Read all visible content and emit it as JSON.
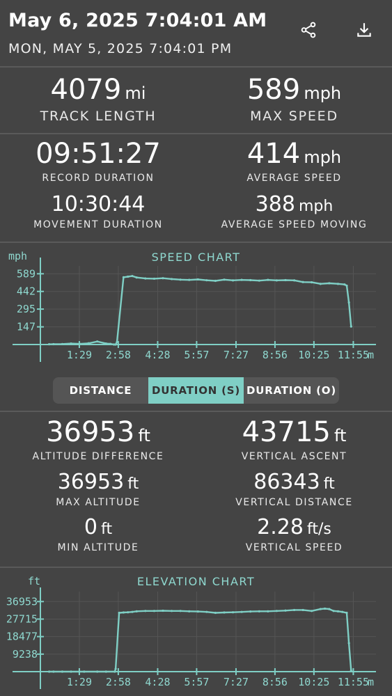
{
  "header": {
    "title": "May 6, 2025 7:04:01 AM",
    "subtitle": "MON, MAY 5, 2025 7:04:01 PM",
    "icons": [
      "share-icon",
      "download-icon"
    ]
  },
  "stats_top": {
    "track_length": {
      "value": "4079",
      "unit": "mi",
      "label": "TRACK LENGTH"
    },
    "max_speed": {
      "value": "589",
      "unit": "mph",
      "label": "MAX SPEED"
    },
    "record_duration": {
      "value": "09:51:27",
      "label": "RECORD DURATION"
    },
    "average_speed": {
      "value": "414",
      "unit": "mph",
      "label": "AVERAGE SPEED"
    },
    "movement_duration": {
      "value": "10:30:44",
      "label": "MOVEMENT DURATION"
    },
    "average_speed_moving": {
      "value": "388",
      "unit": "mph",
      "label": "AVERAGE SPEED MOVING"
    }
  },
  "segmented": {
    "options": [
      "DISTANCE",
      "DURATION (S)",
      "DURATION (O)"
    ],
    "selected": "DURATION (S)"
  },
  "stats_bottom": {
    "altitude_difference": {
      "value": "36953",
      "unit": "ft",
      "label": "ALTITUDE DIFFERENCE"
    },
    "vertical_ascent": {
      "value": "43715",
      "unit": "ft",
      "label": "VERTICAL ASCENT"
    },
    "max_altitude": {
      "value": "36953",
      "unit": "ft",
      "label": "MAX ALTITUDE"
    },
    "vertical_distance": {
      "value": "86343",
      "unit": "ft",
      "label": "VERTICAL DISTANCE"
    },
    "min_altitude": {
      "value": "0",
      "unit": "ft",
      "label": "MIN ALTITUDE"
    },
    "vertical_speed": {
      "value": "2.28",
      "unit": "ft/s",
      "label": "VERTICAL SPEED"
    }
  },
  "colors": {
    "accent": "#7fcfc5",
    "background": "#444444",
    "divider": "#5a5a5a"
  },
  "chart_data": [
    {
      "type": "line",
      "title": "SPEED CHART",
      "ylabel": "mph",
      "xlabel": "m",
      "y_ticks": [
        "589",
        "442",
        "295",
        "147"
      ],
      "y_tick_values": [
        589,
        442,
        295,
        147
      ],
      "x_ticks": [
        "1:29",
        "2:58",
        "4:28",
        "5:57",
        "7:27",
        "8:56",
        "10:25",
        "11:55"
      ],
      "x_tick_values": [
        89,
        178,
        268,
        357,
        447,
        536,
        625,
        715
      ],
      "xlim": [
        0,
        770
      ],
      "ylim": [
        0,
        620
      ],
      "grid": true,
      "x": [
        20,
        30,
        50,
        70,
        90,
        110,
        130,
        150,
        160,
        168,
        172,
        175,
        190,
        200,
        210,
        220,
        240,
        260,
        280,
        300,
        320,
        340,
        360,
        380,
        400,
        420,
        440,
        460,
        480,
        500,
        520,
        540,
        560,
        580,
        600,
        620,
        640,
        660,
        680,
        695,
        700,
        705,
        710
      ],
      "y": [
        2,
        3,
        4,
        8,
        5,
        10,
        25,
        8,
        5,
        0,
        0,
        20,
        560,
        565,
        570,
        558,
        550,
        548,
        552,
        545,
        540,
        538,
        542,
        535,
        530,
        540,
        534,
        538,
        536,
        532,
        538,
        534,
        536,
        534,
        520,
        518,
        505,
        510,
        505,
        500,
        490,
        350,
        150
      ]
    },
    {
      "type": "line",
      "title": "ELEVATION CHART",
      "ylabel": "ft",
      "xlabel": "m",
      "y_ticks": [
        "36953",
        "27715",
        "18477",
        "9238"
      ],
      "y_tick_values": [
        36953,
        27715,
        18477,
        9238
      ],
      "x_ticks": [
        "1:29",
        "2:58",
        "4:28",
        "5:57",
        "7:27",
        "8:56",
        "10:25",
        "11:55"
      ],
      "x_tick_values": [
        89,
        178,
        268,
        357,
        447,
        536,
        625,
        715
      ],
      "xlim": [
        0,
        770
      ],
      "ylim": [
        0,
        40000
      ],
      "grid": true,
      "x": [
        20,
        30,
        50,
        70,
        100,
        130,
        150,
        170,
        172,
        180,
        190,
        200,
        210,
        220,
        240,
        260,
        280,
        300,
        320,
        340,
        360,
        380,
        400,
        420,
        440,
        460,
        480,
        500,
        520,
        540,
        560,
        580,
        600,
        620,
        640,
        650,
        660,
        670,
        680,
        690,
        700,
        705,
        710
      ],
      "y": [
        0,
        0,
        0,
        0,
        0,
        0,
        0,
        0,
        1500,
        31000,
        31200,
        31300,
        31500,
        31800,
        32000,
        32000,
        32100,
        32000,
        32000,
        31800,
        31700,
        31500,
        31000,
        31200,
        31300,
        31500,
        31700,
        31800,
        31800,
        32000,
        32200,
        32500,
        32500,
        32000,
        33000,
        33200,
        33000,
        32000,
        31800,
        31500,
        31000,
        15000,
        500
      ]
    }
  ]
}
